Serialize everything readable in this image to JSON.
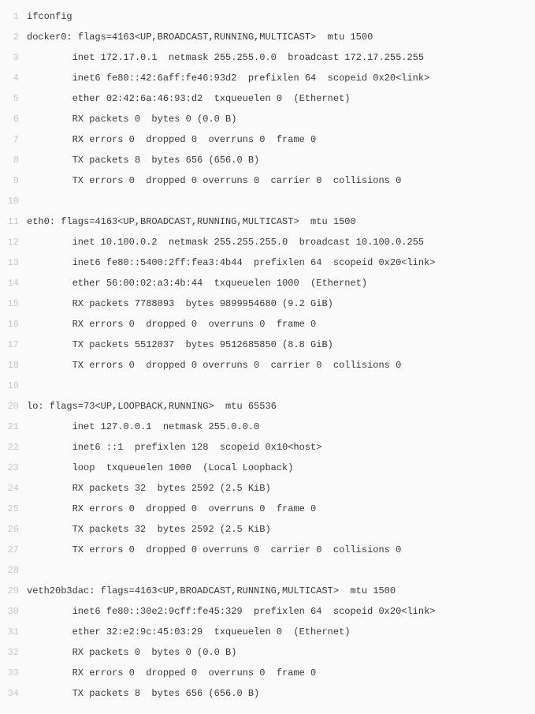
{
  "lines": [
    "ifconfig",
    "docker0: flags=4163<UP,BROADCAST,RUNNING,MULTICAST>  mtu 1500",
    "        inet 172.17.0.1  netmask 255.255.0.0  broadcast 172.17.255.255",
    "        inet6 fe80::42:6aff:fe46:93d2  prefixlen 64  scopeid 0x20<link>",
    "        ether 02:42:6a:46:93:d2  txqueuelen 0  (Ethernet)",
    "        RX packets 0  bytes 0 (0.0 B)",
    "        RX errors 0  dropped 0  overruns 0  frame 0",
    "        TX packets 8  bytes 656 (656.0 B)",
    "        TX errors 0  dropped 0 overruns 0  carrier 0  collisions 0",
    "",
    "eth0: flags=4163<UP,BROADCAST,RUNNING,MULTICAST>  mtu 1500",
    "        inet 10.100.0.2  netmask 255.255.255.0  broadcast 10.100.0.255",
    "        inet6 fe80::5400:2ff:fea3:4b44  prefixlen 64  scopeid 0x20<link>",
    "        ether 56:00:02:a3:4b:44  txqueuelen 1000  (Ethernet)",
    "        RX packets 7788093  bytes 9899954680 (9.2 GiB)",
    "        RX errors 0  dropped 0  overruns 0  frame 0",
    "        TX packets 5512037  bytes 9512685850 (8.8 GiB)",
    "        TX errors 0  dropped 0 overruns 0  carrier 0  collisions 0",
    "",
    "lo: flags=73<UP,LOOPBACK,RUNNING>  mtu 65536",
    "        inet 127.0.0.1  netmask 255.0.0.0",
    "        inet6 ::1  prefixlen 128  scopeid 0x10<host>",
    "        loop  txqueuelen 1000  (Local Loopback)",
    "        RX packets 32  bytes 2592 (2.5 KiB)",
    "        RX errors 0  dropped 0  overruns 0  frame 0",
    "        TX packets 32  bytes 2592 (2.5 KiB)",
    "        TX errors 0  dropped 0 overruns 0  carrier 0  collisions 0",
    "",
    "veth20b3dac: flags=4163<UP,BROADCAST,RUNNING,MULTICAST>  mtu 1500",
    "        inet6 fe80::30e2:9cff:fe45:329  prefixlen 64  scopeid 0x20<link>",
    "        ether 32:e2:9c:45:03:29  txqueuelen 0  (Ethernet)",
    "        RX packets 0  bytes 0 (0.0 B)",
    "        RX errors 0  dropped 0  overruns 0  frame 0",
    "        TX packets 8  bytes 656 (656.0 B)"
  ]
}
